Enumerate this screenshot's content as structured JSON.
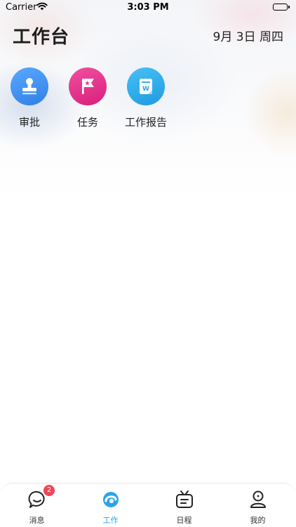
{
  "status_bar": {
    "carrier": "Carrier",
    "time": "3:03 PM"
  },
  "header": {
    "title": "工作台",
    "date": "9月 3日 周四"
  },
  "apps": [
    {
      "label": "审批",
      "icon": "approval-stamp-icon",
      "color": "#3a8ef0"
    },
    {
      "label": "任务",
      "icon": "task-flag-icon",
      "color": "#e8308a"
    },
    {
      "label": "工作报告",
      "icon": "work-report-icon",
      "color": "#2ba4e8"
    }
  ],
  "tabbar": {
    "active_color": "#2ba4e8",
    "items": [
      {
        "label": "消息",
        "icon": "message-bubble-icon",
        "badge": "2"
      },
      {
        "label": "工作",
        "icon": "work-icon",
        "active": true
      },
      {
        "label": "日程",
        "icon": "schedule-tv-icon"
      },
      {
        "label": "我的",
        "icon": "profile-icon"
      }
    ]
  }
}
